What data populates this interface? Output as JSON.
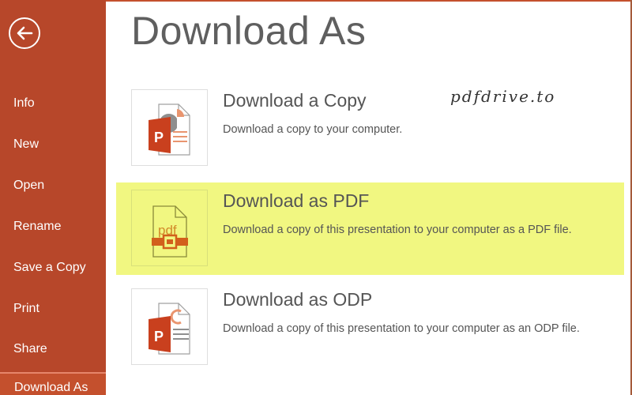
{
  "sidebar": {
    "back_icon": "circle-arrow-left-icon",
    "items": [
      {
        "label": "Info"
      },
      {
        "label": "New"
      },
      {
        "label": "Open"
      },
      {
        "label": "Rename"
      },
      {
        "label": "Save a Copy"
      },
      {
        "label": "Print"
      },
      {
        "label": "Share"
      }
    ],
    "active_item": {
      "label": "Download As"
    }
  },
  "main": {
    "title": "Download As",
    "options": [
      {
        "title": "Download a Copy",
        "description": "Download a copy to your computer.",
        "icon": "powerpoint-file-icon"
      },
      {
        "title": "Download as PDF",
        "description": "Download a copy of this presentation to your computer as a PDF file.",
        "icon": "pdf-file-icon",
        "highlighted": true
      },
      {
        "title": "Download as ODP",
        "description": "Download a copy of this presentation to your computer as an ODP file.",
        "icon": "odp-file-icon"
      }
    ]
  },
  "watermark": "pdfdrive.to",
  "colors": {
    "sidebar": "#b7472a",
    "active_item": "#c4502d",
    "highlight": "#f1f781"
  }
}
